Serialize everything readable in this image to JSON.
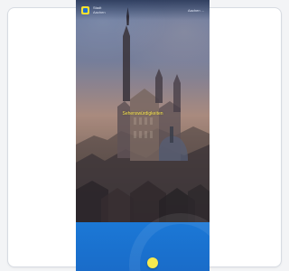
{
  "brand": {
    "line1": "Stadt",
    "line2": "Aachen"
  },
  "top_right": "Aachen ...",
  "headline": "Sehenswürdigkeiten",
  "colors": {
    "headline": "#f8e64b",
    "footer": "#1a6cc9",
    "logo_yellow": "#f7e12f"
  }
}
